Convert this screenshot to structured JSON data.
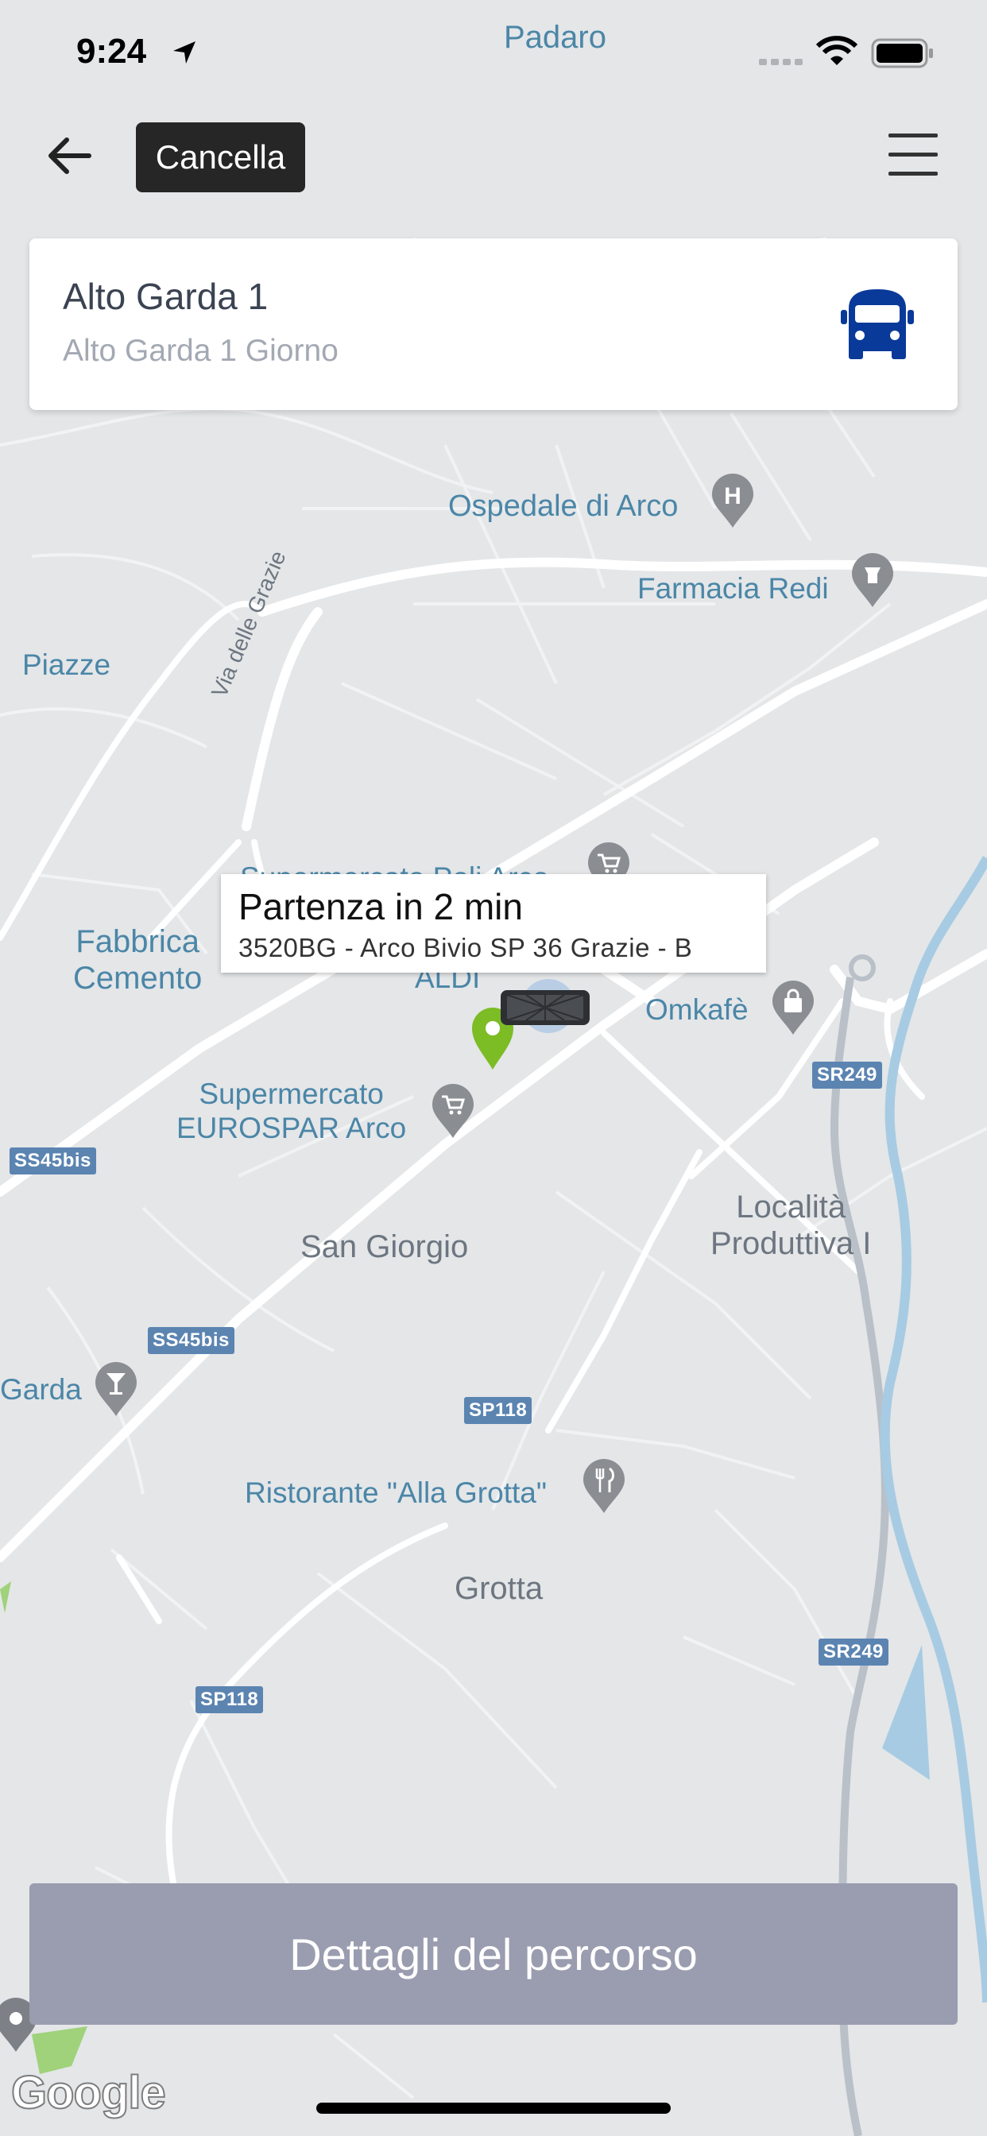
{
  "status_bar": {
    "time": "9:24"
  },
  "top_bar": {
    "cancel_label": "Cancella"
  },
  "route_card": {
    "title": "Alto Garda 1",
    "subtitle": "Alto Garda 1 Giorno"
  },
  "callout": {
    "title": "Partenza in 2 min",
    "subtitle": "3520BG - Arco Bivio SP 36 Grazie - B"
  },
  "map": {
    "places": {
      "padaro": "Padaro",
      "ospedale": "Ospedale di Arco",
      "farmacia": "Farmacia Redi",
      "piazze": "Piazze",
      "via_grazie": "Via delle Grazie",
      "supermercato_poli": "Supermercato Poli Arco",
      "fabbrica_1": "Fabbrica",
      "fabbrica_2": "Cemento",
      "aldi": "ALDI",
      "omkafe": "Omkafè",
      "eurospar_1": "Supermercato",
      "eurospar_2": "EUROSPAR Arco",
      "san_giorgio": "San Giorgio",
      "localita_1": "Località",
      "localita_2": "Produttiva I",
      "garda": "Garda",
      "ristorante": "Ristorante \"Alla Grotta\"",
      "grotta": "Grotta"
    },
    "roads": {
      "sr249_a": "SR249",
      "sr249_b": "SR249",
      "ss45bis_a": "SS45bis",
      "ss45bis_b": "SS45bis",
      "sp118_a": "SP118",
      "sp118_b": "SP118"
    },
    "attribution": "Google"
  },
  "bottom": {
    "details_label": "Dettagli del percorso"
  },
  "colors": {
    "map_bg": "#e4e6e8",
    "road": "#ffffff",
    "river": "#a7cbe3",
    "label": "#4b86a7",
    "bus": "#0a3a99",
    "stop_pin": "#7cbc24",
    "button_disabled": "#9a9caf"
  }
}
